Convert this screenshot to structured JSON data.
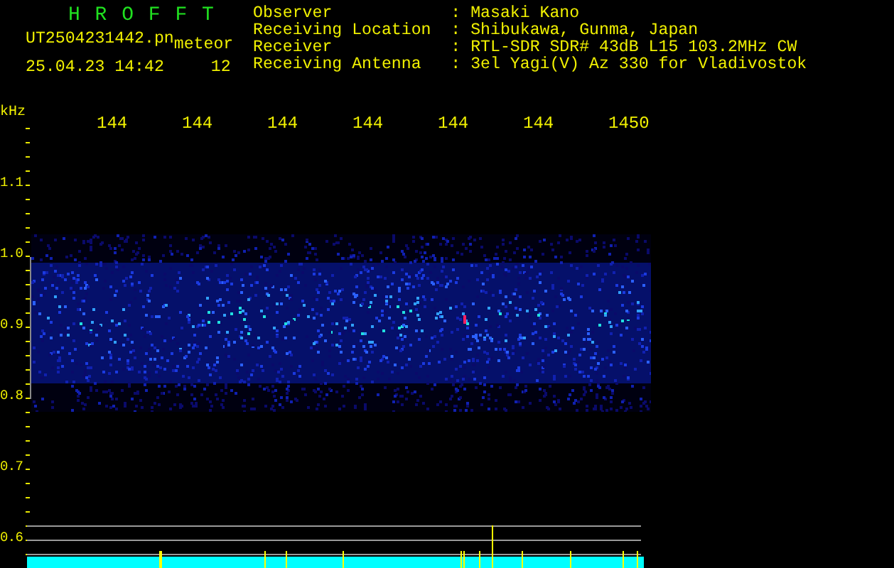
{
  "title": "H R O F F T",
  "file_name": "UT2504231442.pn",
  "event_type": "meteor",
  "date_time": "25.04.23 14:42",
  "count": "12",
  "station": [
    {
      "label": "Observer",
      "value": ": Masaki Kano"
    },
    {
      "label": "Receiving Location",
      "value": ": Shibukawa, Gunma, Japan"
    },
    {
      "label": "Receiver",
      "value": ": RTL-SDR SDR# 43dB L15 103.2MHz CW"
    },
    {
      "label": "Receiving Antenna",
      "value": ": 3el Yagi(V) Az 330 for Vladivostok"
    }
  ],
  "frequency_unit": "kHz",
  "frequency_labels": [
    "144",
    "144",
    "144",
    "144",
    "144",
    "144",
    "1450"
  ],
  "y_labels": [
    "1.1",
    "1.0",
    "0.9",
    "0.8",
    "0.7",
    "0.6"
  ]
}
